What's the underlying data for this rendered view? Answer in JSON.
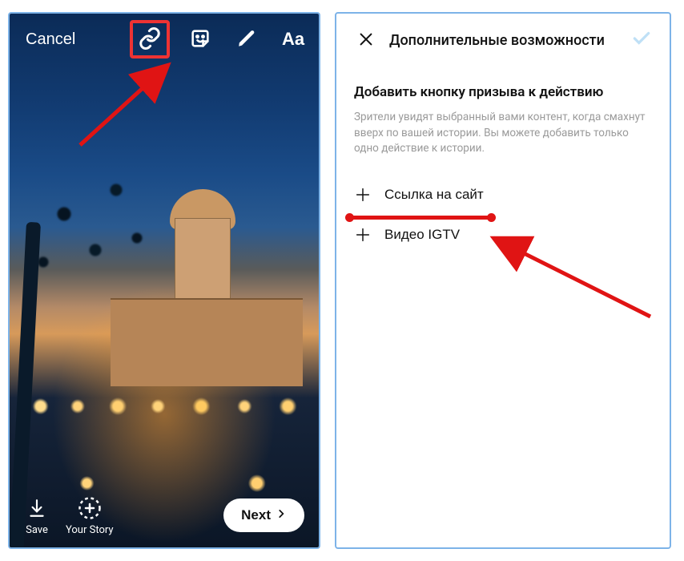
{
  "left": {
    "cancel": "Cancel",
    "toolbar": {
      "link_icon": "link-icon",
      "sticker_icon": "sticker-icon",
      "draw_icon": "draw-icon",
      "text_label": "Aa"
    },
    "bottom": {
      "save_label": "Save",
      "your_story_label": "Your Story",
      "next_label": "Next"
    }
  },
  "right": {
    "header_title": "Дополнительные возможности",
    "section_title": "Добавить кнопку призыва к действию",
    "section_desc": "Зрители увидят выбранный вами контент, когда смахнут вверх по вашей истории. Вы можете добавить только одно действие к истории.",
    "options": [
      {
        "label": "Ссылка на сайт"
      },
      {
        "label": "Видео IGTV"
      }
    ]
  },
  "annotations": {
    "highlight_color": "#e33",
    "arrow_color": "#e01414"
  }
}
